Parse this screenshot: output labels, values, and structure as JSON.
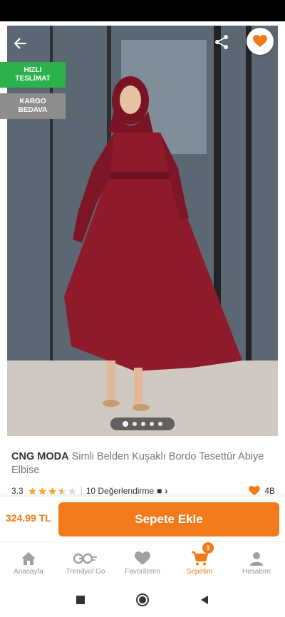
{
  "product": {
    "brand": "CNG MODA",
    "name": "Simli Belden Kuşaklı Bordo Tesettür Abiye Elbise",
    "rating": "3.3",
    "stars": 3.5,
    "review_count": "10 Değerlendirme",
    "favorite_count": "4B",
    "price": "324.99 TL"
  },
  "badges": {
    "fast_line1": "HIZLI",
    "fast_line2": "TESLİMAT",
    "cargo_line1": "KARGO",
    "cargo_line2": "BEDAVA"
  },
  "gallery": {
    "image_count": 5,
    "active_index": 0
  },
  "cta": {
    "add_to_cart": "Sepete Ekle"
  },
  "tabs": [
    {
      "label": "Anasayfa",
      "icon": "home-icon"
    },
    {
      "label": "Trendyol Go",
      "icon": "go-icon"
    },
    {
      "label": "Favorilerim",
      "icon": "heart-icon"
    },
    {
      "label": "Sepetim",
      "icon": "cart-icon",
      "badge": "3"
    },
    {
      "label": "Hesabım",
      "icon": "user-icon"
    }
  ],
  "colors": {
    "accent": "#f27a1a",
    "fast_badge": "#2bb24c",
    "cargo_badge": "#8e8e8e"
  }
}
